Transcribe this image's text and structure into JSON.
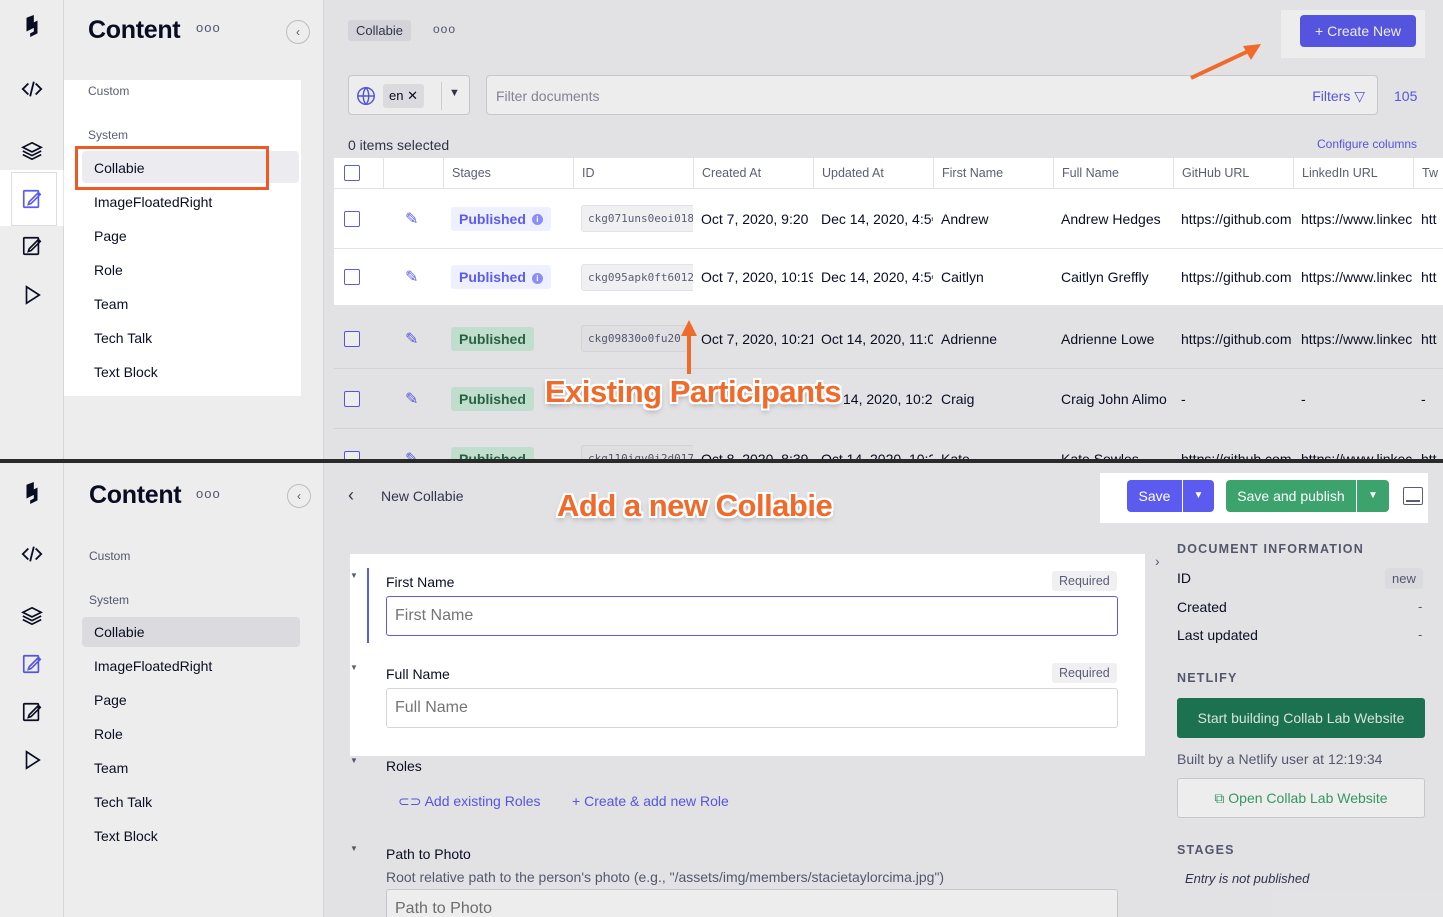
{
  "top": {
    "nav_title": "Content",
    "sections": {
      "custom": "Custom",
      "system": "System"
    },
    "models": [
      "Collabie",
      "ImageFloatedRight",
      "Page",
      "Role",
      "Team",
      "Tech Talk",
      "Text Block"
    ],
    "breadcrumb": "Collabie",
    "create_new": "Create New",
    "locale": "en",
    "filter_placeholder": "Filter documents",
    "filters_label": "Filters",
    "total_count": "105",
    "selected_info": "0 items selected",
    "configure_columns": "Configure columns",
    "columns": [
      "Stages",
      "ID",
      "Created At",
      "Updated At",
      "First Name",
      "Full Name",
      "GitHub URL",
      "LinkedIn URL",
      "Tw"
    ],
    "rows": [
      {
        "stage": "Published",
        "id": "ckg071uns0eoi018",
        "created": "Oct 7, 2020, 9:20 I",
        "updated": "Dec 14, 2020, 4:5€",
        "first": "Andrew",
        "full": "Andrew Hedges",
        "github": "https://github.com",
        "linkedin": "https://www.linkec",
        "tw": "htt"
      },
      {
        "stage": "Published",
        "id": "ckg095apk0ft6012",
        "created": "Oct 7, 2020, 10:19",
        "updated": "Dec 14, 2020, 4:5€",
        "first": "Caitlyn",
        "full": "Caitlyn Greffly",
        "github": "https://github.com",
        "linkedin": "https://www.linkec",
        "tw": "htt"
      },
      {
        "stage": "Published",
        "id": "ckg09830o0fu20",
        "created": "Oct 7, 2020, 10:21",
        "updated": "Oct 14, 2020, 11:0!",
        "first": "Adrienne",
        "full": "Adrienne Lowe",
        "github": "https://github.com",
        "linkedin": "https://www.linkec",
        "tw": "htt"
      },
      {
        "stage": "Published",
        "id": "",
        "created": "",
        "updated": "14, 2020, 10:2",
        "first": "Craig",
        "full": "Craig John Alimo",
        "github": "-",
        "linkedin": "-",
        "tw": "-"
      },
      {
        "stage": "Published",
        "id": "ckg110iqv0i2d017",
        "created": "Oct 8, 2020, 8:39",
        "updated": "Oct 14, 2020, 10:2",
        "first": "Kate",
        "full": "Kate Sowles",
        "github": "https://github.com",
        "linkedin": "https://www.linkec",
        "tw": "htt"
      }
    ],
    "annotation": "Existing Participants"
  },
  "bottom": {
    "nav_title": "Content",
    "sections": {
      "custom": "Custom",
      "system": "System"
    },
    "models": [
      "Collabie",
      "ImageFloatedRight",
      "Page",
      "Role",
      "Team",
      "Tech Talk",
      "Text Block"
    ],
    "page_title": "New Collabie",
    "save": "Save",
    "save_publish": "Save and publish",
    "annotation": "Add a new Collabie",
    "fields": {
      "first_name": {
        "label": "First Name",
        "required": "Required",
        "placeholder": "First Name"
      },
      "full_name": {
        "label": "Full Name",
        "required": "Required",
        "placeholder": "Full Name"
      },
      "roles": {
        "label": "Roles",
        "add_existing": "Add existing Roles",
        "create_new": "Create & add new Role"
      },
      "photo": {
        "label": "Path to Photo",
        "help": "Root relative path to the person's photo (e.g., \"/assets/img/members/stacietaylorcima.jpg\")",
        "placeholder": "Path to Photo"
      }
    },
    "doc_info": {
      "heading": "DOCUMENT INFORMATION",
      "id_label": "ID",
      "id_value": "new",
      "created_label": "Created",
      "created_value": "-",
      "updated_label": "Last updated",
      "updated_value": "-"
    },
    "netlify": {
      "heading": "NETLIFY",
      "build_button": "Start building Collab Lab Website",
      "built_by": "Built by a Netlify user at 12:19:34",
      "open_button": "Open Collab Lab Website"
    },
    "stages": {
      "heading": "STAGES",
      "text": "Entry is not published"
    }
  },
  "colors": {
    "accent": "#5b5bf0",
    "publish_green": "#3ba36b",
    "annotation_orange": "#ef6a2b"
  }
}
